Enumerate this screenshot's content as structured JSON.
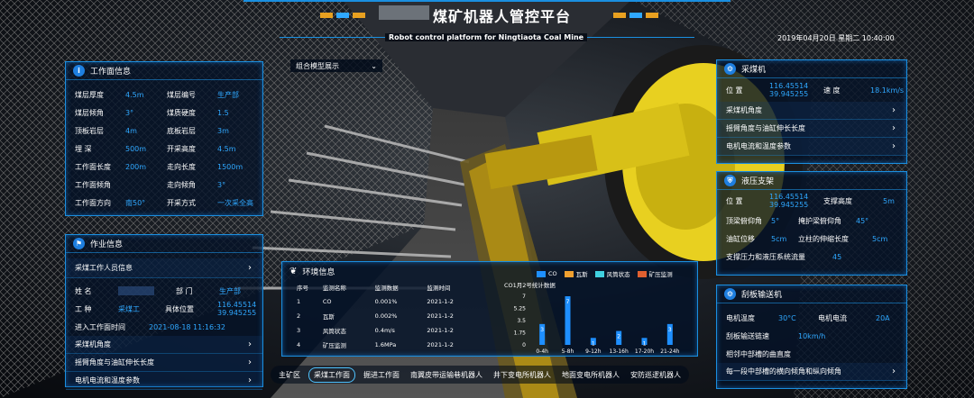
{
  "header": {
    "title": "煤矿机器人管控平台",
    "subtitle": "Robot control platform for Ningtiaota Coal Mine",
    "datetime": "2019年04月20日 星期二 10:40:00"
  },
  "model_select": {
    "label": "组合模型展示"
  },
  "work_face": {
    "title": "工作面信息",
    "rows": [
      {
        "l1": "煤层厚度",
        "v1": "4.5m",
        "l2": "煤层编号",
        "v2": "生产部"
      },
      {
        "l1": "煤层倾角",
        "v1": "3°",
        "l2": "煤质硬度",
        "v2": "1.5"
      },
      {
        "l1": "顶板岩层",
        "v1": "4m",
        "l2": "底板岩层",
        "v2": "3m"
      },
      {
        "l1": "埋 深",
        "v1": "500m",
        "l2": "开采高度",
        "v2": "4.5m"
      },
      {
        "l1": "工作面长度",
        "v1": "200m",
        "l2": "走向长度",
        "v2": "1500m"
      },
      {
        "l1": "工作面倾角",
        "v1": "",
        "l2": "走向倾角",
        "v2": "3°"
      },
      {
        "l1": "工作面方向",
        "v1": "南50°",
        "l2": "开采方式",
        "v2": "一次采全高"
      }
    ]
  },
  "work_info": {
    "title": "作业信息",
    "staff_label": "采煤工作人员信息",
    "name_label": "姓 名",
    "dept_label": "部 门",
    "dept_value": "生产部",
    "type_label": "工 种",
    "type_value": "采煤工",
    "pos_label": "具体位置",
    "pos_value1": "116.45514",
    "pos_value2": "39.945255",
    "enter_label": "进入工作面时间",
    "enter_value": "2021-08-18 11:16:32",
    "items": [
      "采煤机角度",
      "摇臂角度与油缸伸长长度",
      "电机电流和温度参数"
    ]
  },
  "shearer": {
    "title": "采煤机",
    "pos_label": "位 置",
    "pos1": "116.45514",
    "pos2": "39.945255",
    "speed_label": "速 度",
    "speed": "18.1km/s",
    "items": [
      "采煤机角度",
      "摇臂角度与油缸伸长长度",
      "电机电流和温度参数"
    ]
  },
  "hydraulic": {
    "title": "液压支架",
    "pos_label": "位 置",
    "pos1": "116.45514",
    "pos2": "39.945255",
    "height_label": "支撑高度",
    "height": "5m",
    "top_label": "顶梁俯仰角",
    "top": "5°",
    "shield_label": "掩护梁俯仰角",
    "shield": "45°",
    "cyl_label": "油缸位移",
    "cyl": "5cm",
    "col_label": "立柱的伸缩长度",
    "col": "5cm",
    "press_label": "支撑压力和液压系统流量",
    "press": "45"
  },
  "conveyor": {
    "title": "刮板输送机",
    "temp_label": "电机温度",
    "temp": "30°C",
    "cur_label": "电机电流",
    "cur": "20A",
    "speed_label": "刮板输送链速",
    "speed": "10km/h",
    "curv_label": "相邻中部槽的曲直度",
    "angle_label": "每一段中部槽的横向倾角和纵向倾角"
  },
  "env": {
    "title": "环境信息",
    "cols": [
      "序号",
      "监测名称",
      "监测数据",
      "监测时间"
    ],
    "rows": [
      [
        "1",
        "CO",
        "0.001%",
        "2021-1-2"
      ],
      [
        "2",
        "瓦斯",
        "0.002%",
        "2021-1-2"
      ],
      [
        "3",
        "风筒状态",
        "0.4m/s",
        "2021-1-2"
      ],
      [
        "4",
        "矿压监测",
        "1.6MPa",
        "2021-1-2"
      ]
    ]
  },
  "legend": [
    {
      "name": "CO",
      "color": "#1e8fff"
    },
    {
      "name": "瓦斯",
      "color": "#f0a030"
    },
    {
      "name": "风筒状态",
      "color": "#40d0e0"
    },
    {
      "name": "矿压监测",
      "color": "#e06030"
    }
  ],
  "chart_data": {
    "type": "bar",
    "title": "CO1月2号统计数据",
    "categories": [
      "0-4h",
      "5-8h",
      "9-12h",
      "13-16h",
      "17-20h",
      "21-24h"
    ],
    "values": [
      3,
      7,
      1,
      2,
      1,
      3
    ],
    "yticks": [
      "7",
      "5.25",
      "3.5",
      "1.75",
      "0"
    ],
    "ylim": [
      0,
      7
    ]
  },
  "nav": [
    "主矿区",
    "采煤工作面",
    "掘进工作面",
    "南翼皮带运输巷机器人",
    "井下变电所机器人",
    "地面变电所机器人",
    "安防巡逻机器人"
  ],
  "nav_active": "采煤工作面"
}
